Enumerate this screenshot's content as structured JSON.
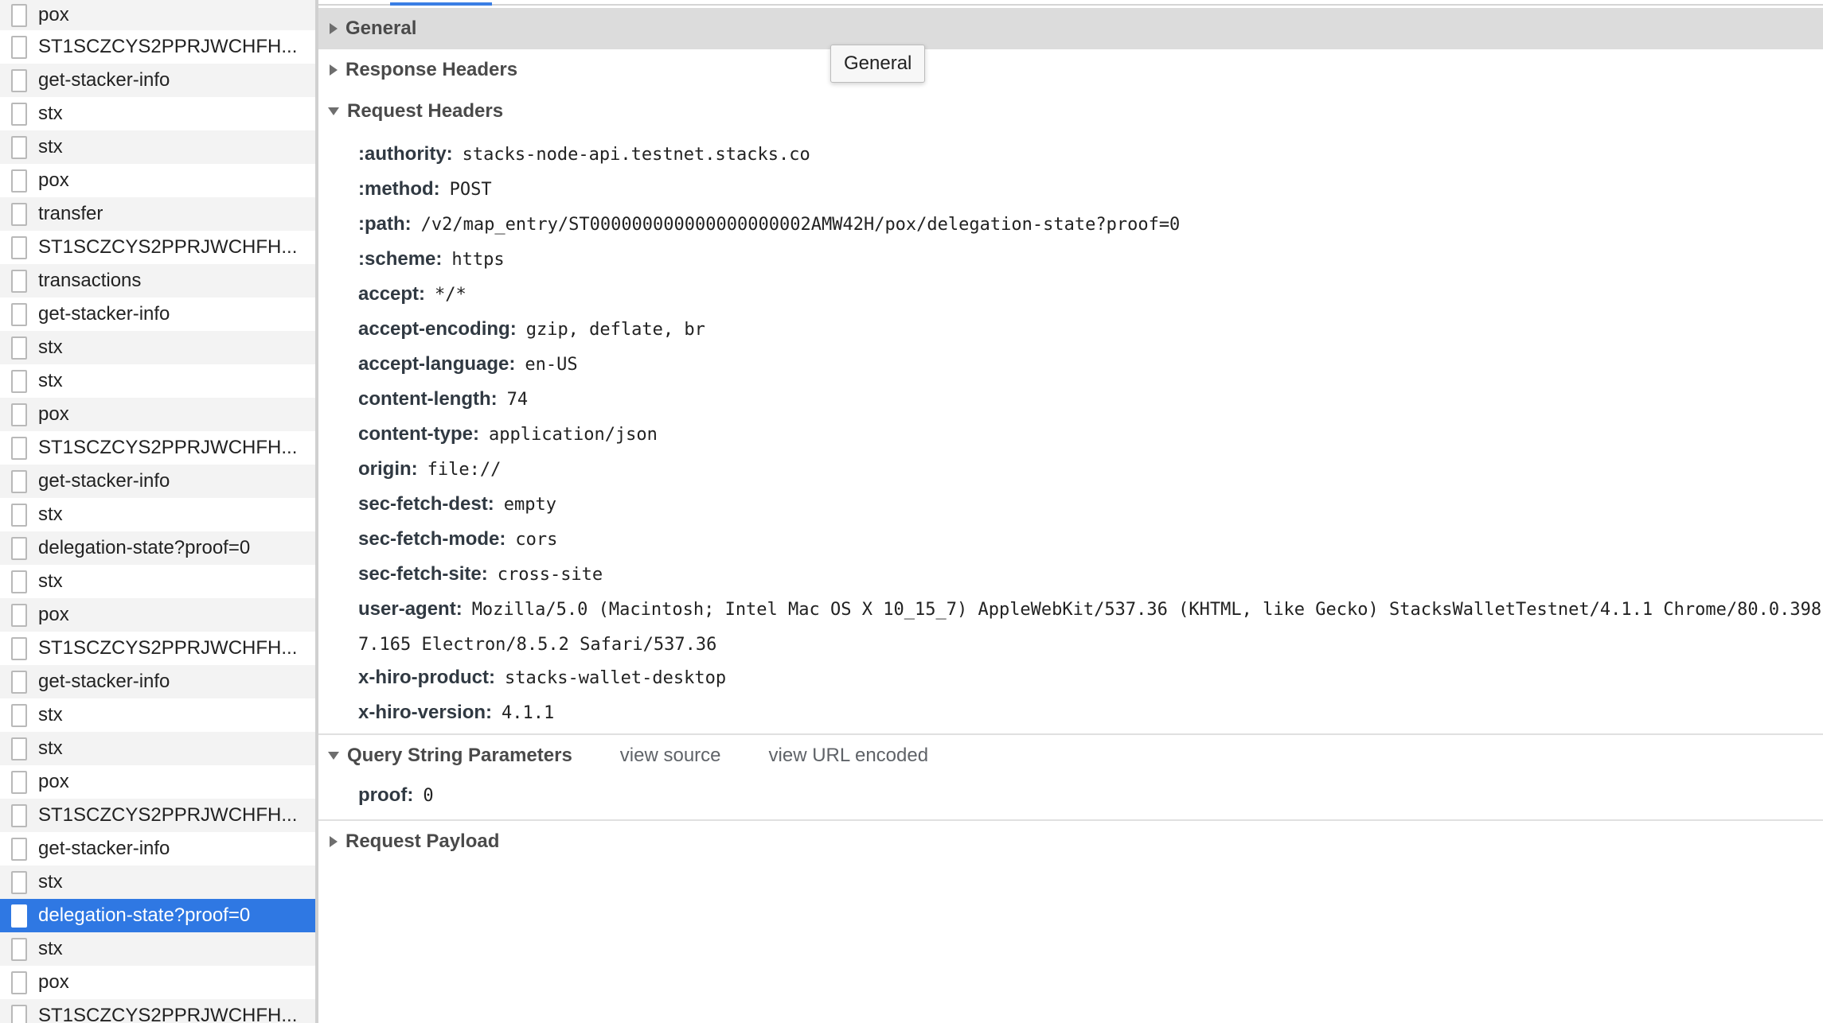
{
  "request_list": [
    {
      "name": "pox",
      "selected": false
    },
    {
      "name": "ST1SCZCYS2PPRJWCHFH...",
      "selected": false
    },
    {
      "name": "get-stacker-info",
      "selected": false
    },
    {
      "name": "stx",
      "selected": false
    },
    {
      "name": "stx",
      "selected": false
    },
    {
      "name": "pox",
      "selected": false
    },
    {
      "name": "transfer",
      "selected": false
    },
    {
      "name": "ST1SCZCYS2PPRJWCHFH...",
      "selected": false
    },
    {
      "name": "transactions",
      "selected": false
    },
    {
      "name": "get-stacker-info",
      "selected": false
    },
    {
      "name": "stx",
      "selected": false
    },
    {
      "name": "stx",
      "selected": false
    },
    {
      "name": "pox",
      "selected": false
    },
    {
      "name": "ST1SCZCYS2PPRJWCHFH...",
      "selected": false
    },
    {
      "name": "get-stacker-info",
      "selected": false
    },
    {
      "name": "stx",
      "selected": false
    },
    {
      "name": "delegation-state?proof=0",
      "selected": false
    },
    {
      "name": "stx",
      "selected": false
    },
    {
      "name": "pox",
      "selected": false
    },
    {
      "name": "ST1SCZCYS2PPRJWCHFH...",
      "selected": false
    },
    {
      "name": "get-stacker-info",
      "selected": false
    },
    {
      "name": "stx",
      "selected": false
    },
    {
      "name": "stx",
      "selected": false
    },
    {
      "name": "pox",
      "selected": false
    },
    {
      "name": "ST1SCZCYS2PPRJWCHFH...",
      "selected": false
    },
    {
      "name": "get-stacker-info",
      "selected": false
    },
    {
      "name": "stx",
      "selected": false
    },
    {
      "name": "delegation-state?proof=0",
      "selected": true
    },
    {
      "name": "stx",
      "selected": false
    },
    {
      "name": "pox",
      "selected": false
    },
    {
      "name": "ST1SCZCYS2PPRJWCHFH...",
      "selected": false
    }
  ],
  "sections": {
    "general": {
      "title": "General",
      "expanded": false
    },
    "response_headers": {
      "title": "Response Headers",
      "expanded": false
    },
    "request_headers": {
      "title": "Request Headers",
      "expanded": true
    },
    "query_string": {
      "title": "Query String Parameters",
      "expanded": true,
      "view_source": "view source",
      "view_url_encoded": "view URL encoded"
    },
    "request_payload": {
      "title": "Request Payload",
      "expanded": false
    }
  },
  "tooltip": "General",
  "request_headers": [
    {
      "key": ":authority:",
      "value": "stacks-node-api.testnet.stacks.co"
    },
    {
      "key": ":method:",
      "value": "POST"
    },
    {
      "key": ":path:",
      "value": "/v2/map_entry/ST000000000000000000002AMW42H/pox/delegation-state?proof=0"
    },
    {
      "key": ":scheme:",
      "value": "https"
    },
    {
      "key": "accept:",
      "value": "*/*"
    },
    {
      "key": "accept-encoding:",
      "value": "gzip, deflate, br"
    },
    {
      "key": "accept-language:",
      "value": "en-US"
    },
    {
      "key": "content-length:",
      "value": "74"
    },
    {
      "key": "content-type:",
      "value": "application/json"
    },
    {
      "key": "origin:",
      "value": "file://"
    },
    {
      "key": "sec-fetch-dest:",
      "value": "empty"
    },
    {
      "key": "sec-fetch-mode:",
      "value": "cors"
    },
    {
      "key": "sec-fetch-site:",
      "value": "cross-site"
    },
    {
      "key": "user-agent:",
      "value": "Mozilla/5.0 (Macintosh; Intel Mac OS X 10_15_7) AppleWebKit/537.36 (KHTML, like Gecko) StacksWalletTestnet/4.1.1 Chrome/80.0.398",
      "continuation": "7.165 Electron/8.5.2 Safari/537.36"
    },
    {
      "key": "x-hiro-product:",
      "value": "stacks-wallet-desktop"
    },
    {
      "key": "x-hiro-version:",
      "value": "4.1.1"
    }
  ],
  "query_params": [
    {
      "key": "proof:",
      "value": "0"
    }
  ],
  "colors": {
    "selected_row": "#2f78e3",
    "tab_indicator": "#3a7ee4",
    "section_highlight": "#dcdcdc"
  }
}
